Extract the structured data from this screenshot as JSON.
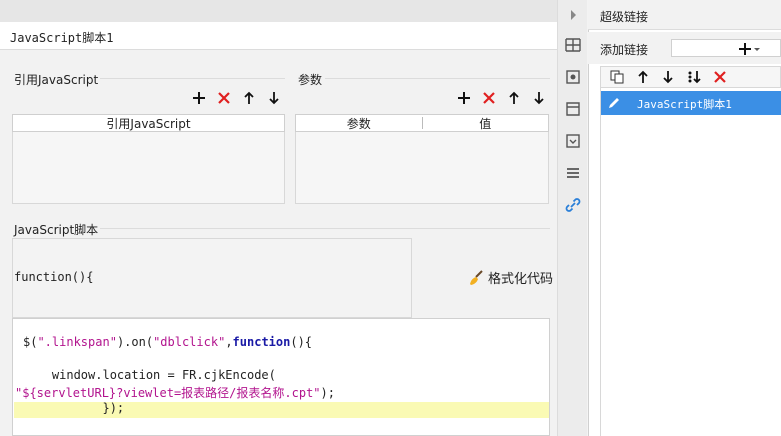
{
  "editor": {
    "tab_title": "JavaScript脚本1",
    "ref_section_title": "引用JavaScript",
    "params_section_title": "参数",
    "ref_table": {
      "columns": [
        "引用JavaScript"
      ],
      "rows": []
    },
    "params_table": {
      "columns": [
        "参数",
        "值"
      ],
      "rows": []
    },
    "script_section_title": "JavaScript脚本",
    "function_header": "function(){",
    "format_button_label": "格式化代码",
    "code": {
      "line1_a": "$(",
      "line1_str1": "\".linkspan\"",
      "line1_b": ").on(",
      "line1_str2": "\"dblclick\"",
      "line1_c": ",",
      "line1_kw": "function",
      "line1_d": "(){",
      "line2": "    window.location = FR.cjkEncode(",
      "line3_str": "\"${servletURL}?viewlet=报表路径/报表名称.cpt\"",
      "line3_end": ");",
      "line4": "           });"
    }
  },
  "hyperlink_panel": {
    "title": "超级链接",
    "add_label": "添加链接",
    "items": [
      {
        "label": "JavaScript脚本1",
        "selected": true
      }
    ]
  },
  "colors": {
    "delete_red": "#e02020",
    "selection_blue": "#3b8fe5",
    "string_magenta": "#b2148e",
    "keyword_blue": "#1a1aa6",
    "current_line": "#fafab4"
  },
  "icons": {
    "add": "plus-icon",
    "delete": "x-icon",
    "up": "arrow-up-icon",
    "down": "arrow-down-icon",
    "copy": "copy-icon",
    "clear": "broom-icon",
    "edit": "pencil-icon"
  }
}
